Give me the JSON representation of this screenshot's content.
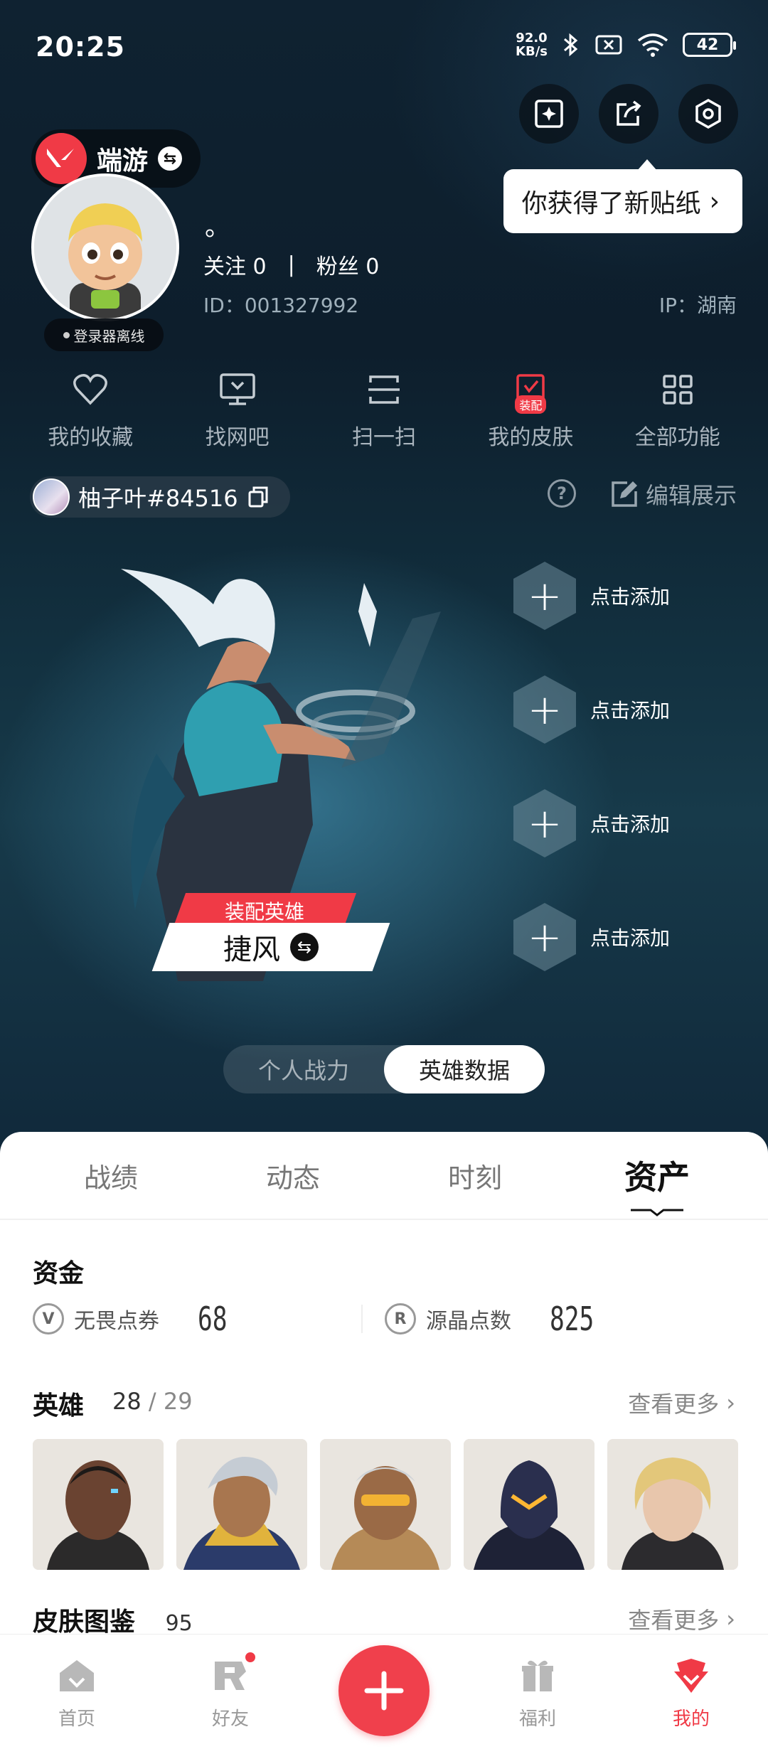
{
  "status_bar": {
    "time": "20:25",
    "net_speed_value": "92.0",
    "net_speed_unit": "KB/s",
    "wifi_label": "6",
    "battery": "42"
  },
  "header": {
    "game_name": "端游",
    "tooltip": "你获得了新贴纸"
  },
  "profile": {
    "nickname": "。",
    "follow_label": "关注",
    "follow_count": "0",
    "fans_label": "粉丝",
    "fans_count": "0",
    "user_id": "ID：001327992",
    "ip_location": "IP：湖南",
    "status": "登录器离线"
  },
  "quick_actions": [
    {
      "label": "我的收藏",
      "icon": "heart-icon"
    },
    {
      "label": "找网吧",
      "icon": "monitor-icon"
    },
    {
      "label": "扫一扫",
      "icon": "scan-icon"
    },
    {
      "label": "我的皮肤",
      "icon": "skin-icon",
      "tag": "装配"
    },
    {
      "label": "全部功能",
      "icon": "grid-icon"
    }
  ],
  "account": {
    "name": "柚子叶#84516",
    "edit_label": "编辑展示"
  },
  "hero_showcase": {
    "equip_tag": "装配英雄",
    "hero_name": "捷风",
    "slots": [
      "点击添加",
      "点击添加",
      "点击添加",
      "点击添加"
    ]
  },
  "toggle": {
    "options": [
      "个人战力",
      "英雄数据"
    ],
    "active": 1
  },
  "tabs": {
    "items": [
      "战绩",
      "动态",
      "时刻",
      "资产"
    ],
    "active": 3
  },
  "assets": {
    "funds_title": "资金",
    "fund_a_label": "无畏点券",
    "fund_a_value": "68",
    "fund_b_label": "源晶点数",
    "fund_b_value": "825",
    "heroes_title": "英雄",
    "heroes_owned": "28",
    "heroes_total": "29",
    "see_more": "查看更多",
    "skins_title": "皮肤图鉴",
    "skins_count": "95"
  },
  "bottom_nav": {
    "home": "首页",
    "friends": "好友",
    "welfare": "福利",
    "mine": "我的"
  },
  "colors": {
    "accent": "#f03a46",
    "background_dark": "#0d1d2a"
  }
}
